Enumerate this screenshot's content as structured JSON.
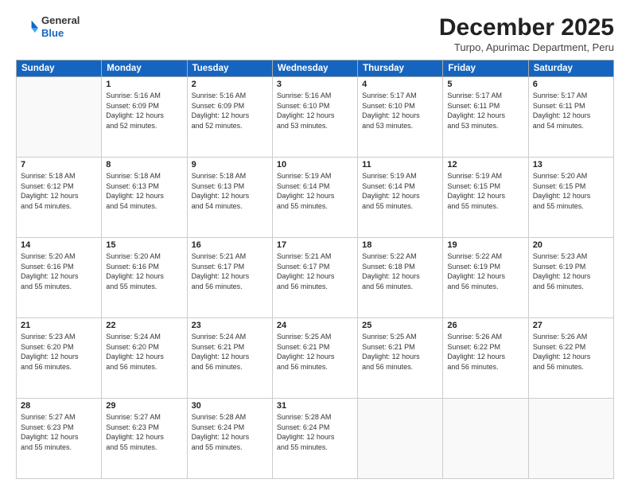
{
  "header": {
    "logo_general": "General",
    "logo_blue": "Blue",
    "month_title": "December 2025",
    "location": "Turpo, Apurimac Department, Peru"
  },
  "days_of_week": [
    "Sunday",
    "Monday",
    "Tuesday",
    "Wednesday",
    "Thursday",
    "Friday",
    "Saturday"
  ],
  "weeks": [
    [
      {
        "day": "",
        "info": ""
      },
      {
        "day": "1",
        "info": "Sunrise: 5:16 AM\nSunset: 6:09 PM\nDaylight: 12 hours\nand 52 minutes."
      },
      {
        "day": "2",
        "info": "Sunrise: 5:16 AM\nSunset: 6:09 PM\nDaylight: 12 hours\nand 52 minutes."
      },
      {
        "day": "3",
        "info": "Sunrise: 5:16 AM\nSunset: 6:10 PM\nDaylight: 12 hours\nand 53 minutes."
      },
      {
        "day": "4",
        "info": "Sunrise: 5:17 AM\nSunset: 6:10 PM\nDaylight: 12 hours\nand 53 minutes."
      },
      {
        "day": "5",
        "info": "Sunrise: 5:17 AM\nSunset: 6:11 PM\nDaylight: 12 hours\nand 53 minutes."
      },
      {
        "day": "6",
        "info": "Sunrise: 5:17 AM\nSunset: 6:11 PM\nDaylight: 12 hours\nand 54 minutes."
      }
    ],
    [
      {
        "day": "7",
        "info": "Sunrise: 5:18 AM\nSunset: 6:12 PM\nDaylight: 12 hours\nand 54 minutes."
      },
      {
        "day": "8",
        "info": "Sunrise: 5:18 AM\nSunset: 6:13 PM\nDaylight: 12 hours\nand 54 minutes."
      },
      {
        "day": "9",
        "info": "Sunrise: 5:18 AM\nSunset: 6:13 PM\nDaylight: 12 hours\nand 54 minutes."
      },
      {
        "day": "10",
        "info": "Sunrise: 5:19 AM\nSunset: 6:14 PM\nDaylight: 12 hours\nand 55 minutes."
      },
      {
        "day": "11",
        "info": "Sunrise: 5:19 AM\nSunset: 6:14 PM\nDaylight: 12 hours\nand 55 minutes."
      },
      {
        "day": "12",
        "info": "Sunrise: 5:19 AM\nSunset: 6:15 PM\nDaylight: 12 hours\nand 55 minutes."
      },
      {
        "day": "13",
        "info": "Sunrise: 5:20 AM\nSunset: 6:15 PM\nDaylight: 12 hours\nand 55 minutes."
      }
    ],
    [
      {
        "day": "14",
        "info": "Sunrise: 5:20 AM\nSunset: 6:16 PM\nDaylight: 12 hours\nand 55 minutes."
      },
      {
        "day": "15",
        "info": "Sunrise: 5:20 AM\nSunset: 6:16 PM\nDaylight: 12 hours\nand 55 minutes."
      },
      {
        "day": "16",
        "info": "Sunrise: 5:21 AM\nSunset: 6:17 PM\nDaylight: 12 hours\nand 56 minutes."
      },
      {
        "day": "17",
        "info": "Sunrise: 5:21 AM\nSunset: 6:17 PM\nDaylight: 12 hours\nand 56 minutes."
      },
      {
        "day": "18",
        "info": "Sunrise: 5:22 AM\nSunset: 6:18 PM\nDaylight: 12 hours\nand 56 minutes."
      },
      {
        "day": "19",
        "info": "Sunrise: 5:22 AM\nSunset: 6:19 PM\nDaylight: 12 hours\nand 56 minutes."
      },
      {
        "day": "20",
        "info": "Sunrise: 5:23 AM\nSunset: 6:19 PM\nDaylight: 12 hours\nand 56 minutes."
      }
    ],
    [
      {
        "day": "21",
        "info": "Sunrise: 5:23 AM\nSunset: 6:20 PM\nDaylight: 12 hours\nand 56 minutes."
      },
      {
        "day": "22",
        "info": "Sunrise: 5:24 AM\nSunset: 6:20 PM\nDaylight: 12 hours\nand 56 minutes."
      },
      {
        "day": "23",
        "info": "Sunrise: 5:24 AM\nSunset: 6:21 PM\nDaylight: 12 hours\nand 56 minutes."
      },
      {
        "day": "24",
        "info": "Sunrise: 5:25 AM\nSunset: 6:21 PM\nDaylight: 12 hours\nand 56 minutes."
      },
      {
        "day": "25",
        "info": "Sunrise: 5:25 AM\nSunset: 6:21 PM\nDaylight: 12 hours\nand 56 minutes."
      },
      {
        "day": "26",
        "info": "Sunrise: 5:26 AM\nSunset: 6:22 PM\nDaylight: 12 hours\nand 56 minutes."
      },
      {
        "day": "27",
        "info": "Sunrise: 5:26 AM\nSunset: 6:22 PM\nDaylight: 12 hours\nand 56 minutes."
      }
    ],
    [
      {
        "day": "28",
        "info": "Sunrise: 5:27 AM\nSunset: 6:23 PM\nDaylight: 12 hours\nand 55 minutes."
      },
      {
        "day": "29",
        "info": "Sunrise: 5:27 AM\nSunset: 6:23 PM\nDaylight: 12 hours\nand 55 minutes."
      },
      {
        "day": "30",
        "info": "Sunrise: 5:28 AM\nSunset: 6:24 PM\nDaylight: 12 hours\nand 55 minutes."
      },
      {
        "day": "31",
        "info": "Sunrise: 5:28 AM\nSunset: 6:24 PM\nDaylight: 12 hours\nand 55 minutes."
      },
      {
        "day": "",
        "info": ""
      },
      {
        "day": "",
        "info": ""
      },
      {
        "day": "",
        "info": ""
      }
    ]
  ]
}
